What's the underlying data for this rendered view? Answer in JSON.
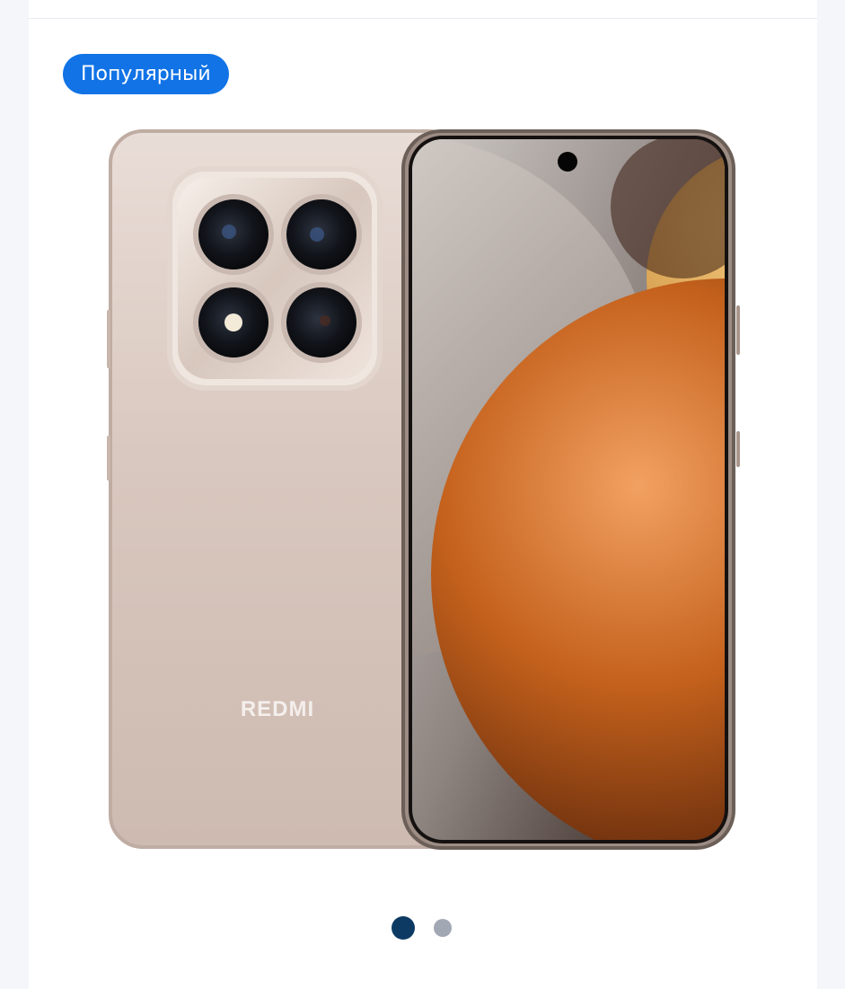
{
  "badge": {
    "label": "Популярный",
    "color": "#1173e6"
  },
  "product": {
    "brand_logo_text": "REDMI",
    "back_color": "#d8c6bd",
    "frame_color": "#b9a59b",
    "screen_accent": "#c4611c"
  },
  "carousel": {
    "active_color": "#0d3a63",
    "inactive_color": "#a2a7b4",
    "slides": [
      {
        "active": true
      },
      {
        "active": false
      }
    ]
  }
}
